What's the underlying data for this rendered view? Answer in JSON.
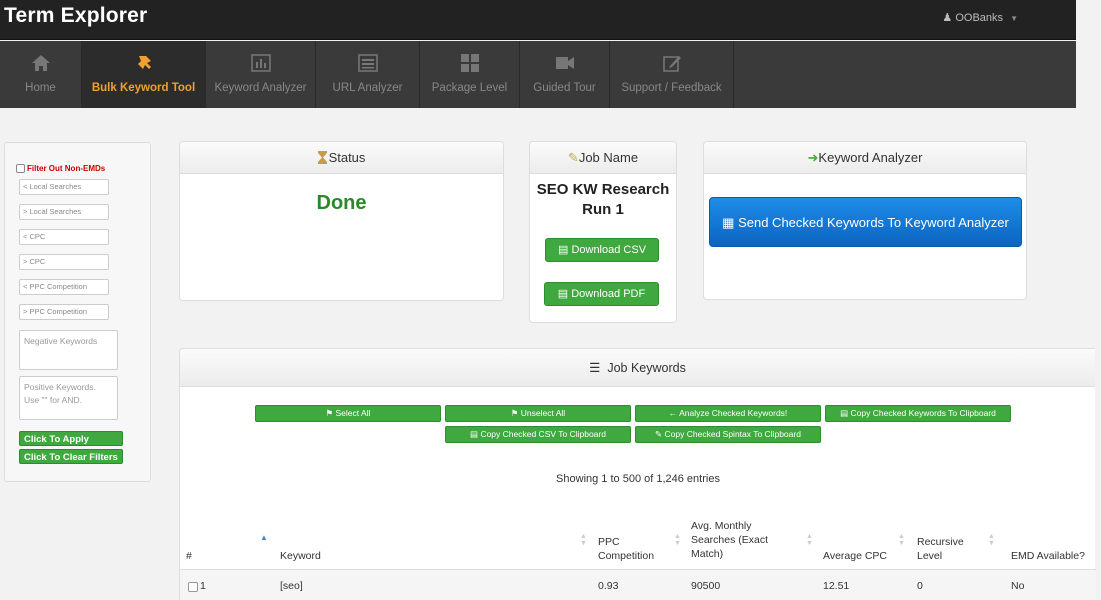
{
  "app": {
    "title": "Term Explorer",
    "user": "OOBanks"
  },
  "nav": [
    {
      "label": "Home",
      "icon": "home-icon"
    },
    {
      "label": "Bulk Keyword Tool",
      "icon": "pushpin-icon"
    },
    {
      "label": "Keyword Analyzer",
      "icon": "bar-chart-icon"
    },
    {
      "label": "URL Analyzer",
      "icon": "list-icon"
    },
    {
      "label": "Package Level",
      "icon": "grid-icon"
    },
    {
      "label": "Guided Tour",
      "icon": "video-camera-icon"
    },
    {
      "label": "Support / Feedback",
      "icon": "edit-icon"
    }
  ],
  "sidebar": {
    "filter_label": "Filter Out Non-EMDs",
    "inputs": [
      "< Local Searches",
      "> Local Searches",
      "< CPC",
      "> CPC",
      "< PPC Competition",
      "> PPC Competition"
    ],
    "negative_placeholder": "Negative Keywords",
    "positive_placeholder": "Positive Keywords. Use \"\" for AND.",
    "apply_label": "Click To Apply Filters",
    "clear_label": "Click To Clear Filters"
  },
  "status": {
    "title": "Status",
    "value": "Done"
  },
  "job": {
    "title": "Job Name",
    "name_line1": "SEO KW Research",
    "name_line2": "Run 1",
    "csv_label": "Download CSV",
    "pdf_label": "Download PDF"
  },
  "analyzer": {
    "title": "Keyword Analyzer",
    "button_label": "Send Checked Keywords To Keyword Analyzer"
  },
  "keywords": {
    "title": "Job Keywords",
    "buttons": {
      "select_all": "Select All",
      "unselect_all": "Unselect All",
      "analyze": "← Analyze Checked Keywords!",
      "copy_keywords": "Copy Checked Keywords To Clipboard",
      "copy_csv": "Copy Checked CSV To Clipboard",
      "copy_spintax": "Copy Checked Spintax To Clipboard"
    },
    "showing": "Showing 1 to 500 of 1,246 entries",
    "columns": {
      "num": "#",
      "keyword": "Keyword",
      "ppc_1": "PPC",
      "ppc_2": "Competition",
      "searches_1": "Avg. Monthly",
      "searches_2": "Searches (Exact",
      "searches_3": "Match)",
      "cpc": "Average CPC",
      "recursive_1": "Recursive",
      "recursive_2": "Level",
      "emd": "EMD Available?"
    },
    "rows": [
      {
        "num": "1",
        "keyword": "[seo]",
        "ppc": "0.93",
        "searches": "90500",
        "cpc": "12.51",
        "recursive": "0",
        "emd": "No"
      }
    ]
  }
}
